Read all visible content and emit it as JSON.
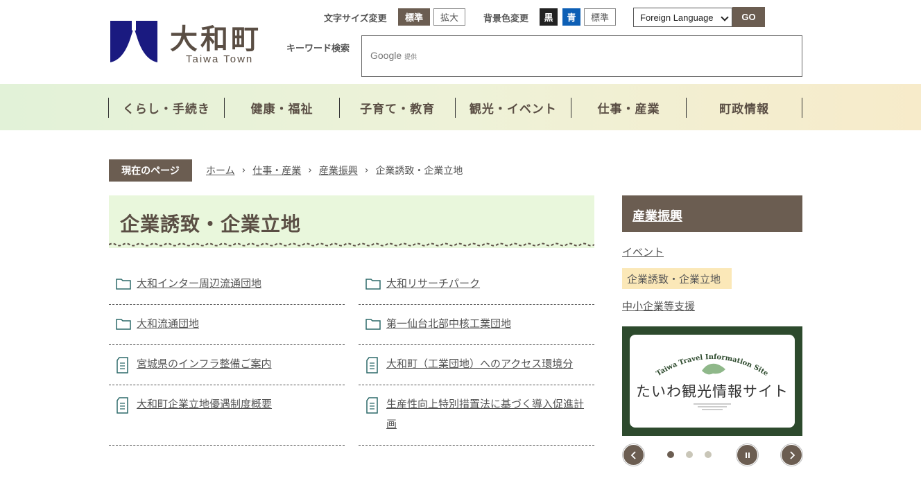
{
  "header": {
    "logo_title": "大和町",
    "logo_sub": "Taiwa Town",
    "font_size_label": "文字サイズ変更",
    "font_size_standard": "標準",
    "font_size_large": "拡大",
    "bg_color_label": "背景色変更",
    "bg_black": "黒",
    "bg_blue": "青",
    "bg_standard": "標準",
    "language_select": "Foreign Language",
    "go_label": "GO",
    "keyword_label": "キーワード検索",
    "search_brand": "Google",
    "search_brand_suffix": "提供"
  },
  "nav": {
    "items": [
      "くらし・手続き",
      "健康・福祉",
      "子育て・教育",
      "観光・イベント",
      "仕事・産業",
      "町政情報"
    ]
  },
  "breadcrumb": {
    "label": "現在のページ",
    "items": [
      "ホーム",
      "仕事・産業",
      "産業振興"
    ],
    "current": "企業誘致・企業立地"
  },
  "page": {
    "title": "企業誘致・企業立地"
  },
  "links": [
    {
      "label": "大和インター周辺流通団地",
      "icon": "folder-icon"
    },
    {
      "label": "大和リサーチパーク",
      "icon": "folder-icon"
    },
    {
      "label": "大和流通団地",
      "icon": "folder-icon"
    },
    {
      "label": "第一仙台北部中核工業団地",
      "icon": "folder-icon"
    },
    {
      "label": "宮城県のインフラ整備ご案内",
      "icon": "document-icon"
    },
    {
      "label": "大和町（工業団地）へのアクセス環境分",
      "icon": "document-icon"
    },
    {
      "label": "大和町企業立地優遇制度概要",
      "icon": "document-icon"
    },
    {
      "label": "生産性向上特別措置法に基づく導入促進計画",
      "icon": "document-icon"
    }
  ],
  "sidebar": {
    "heading": "産業振興",
    "items": [
      "イベント",
      "企業誘致・企業立地",
      "中小企業等支援"
    ],
    "current_index": 1,
    "banner_en": "Taiwa Travel Information Site",
    "banner_jp": "たいわ観光情報サイト",
    "carousel": {
      "slides": 3,
      "active": 0
    }
  },
  "colors": {
    "brand_brown": "#6b5d51",
    "logo_navy": "#1a1a80",
    "folder_teal": "#2d6a6a",
    "title_bg": "#e9f7dc",
    "current_highlight": "#fbe8b8"
  }
}
